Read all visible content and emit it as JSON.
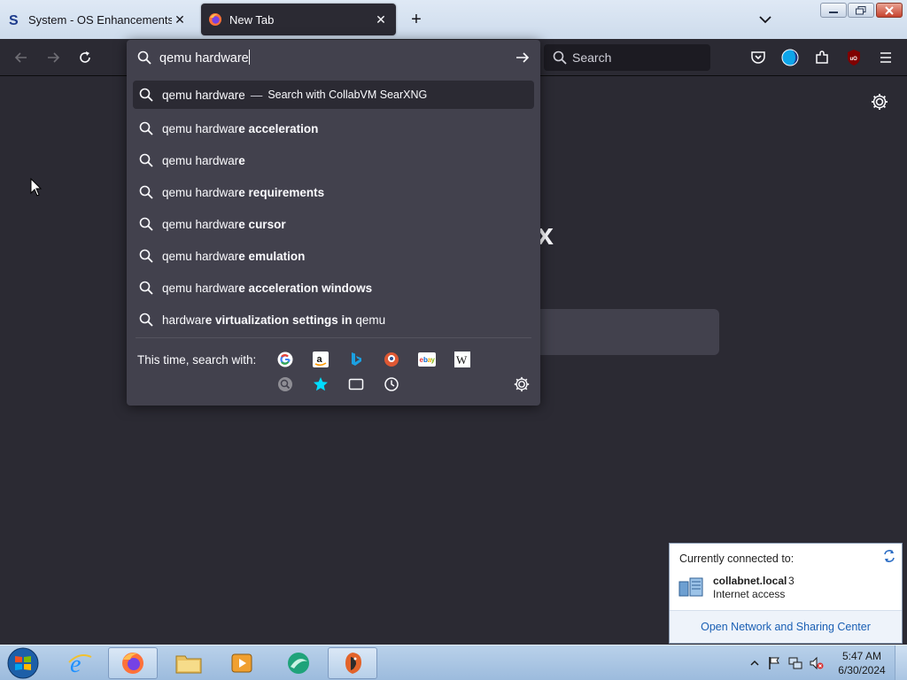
{
  "tabs": [
    {
      "title": "System - OS Enhancements Do",
      "close": "✕",
      "icon": "s-logo-icon"
    },
    {
      "title": "New Tab",
      "close": "✕",
      "icon": "firefox-icon"
    }
  ],
  "toolbar": {
    "newtab_label": "+",
    "search_placeholder": "Search"
  },
  "urlbar": {
    "value": "qemu hardware",
    "suggestions": [
      {
        "prefix": "qemu hardware",
        "bold": "",
        "action": "Search with CollabVM SearXNG",
        "dash": "—"
      },
      {
        "prefix": "qemu hardwar",
        "bold": "e acceleration"
      },
      {
        "prefix": "qemu hardwar",
        "bold": "e"
      },
      {
        "prefix": "qemu hardwar",
        "bold": "e requirements"
      },
      {
        "prefix": "qemu hardwar",
        "bold": "e cursor"
      },
      {
        "prefix": "qemu hardwar",
        "bold": "e emulation"
      },
      {
        "prefix": "qemu hardwar",
        "bold": "e acceleration windows"
      },
      {
        "prefix": "hardwar",
        "bold": "e virtualization settings in",
        "suffix": " qemu"
      }
    ],
    "oneoff_label": "This time, search with:",
    "engines": [
      "google-icon",
      "amazon-icon",
      "bing-icon",
      "duckduckgo-icon",
      "ebay-icon",
      "wikipedia-icon",
      "searxng-icon",
      "bookmarks-icon",
      "tabs-icon",
      "history-icon"
    ]
  },
  "page": {
    "logo_fragment": "x"
  },
  "network_popup": {
    "heading": "Currently connected to:",
    "name": "collabnet.local",
    "count": "3",
    "access": "Internet access",
    "link": "Open Network and Sharing Center"
  },
  "taskbar": {
    "time": "5:47 AM",
    "date": "6/30/2024"
  }
}
